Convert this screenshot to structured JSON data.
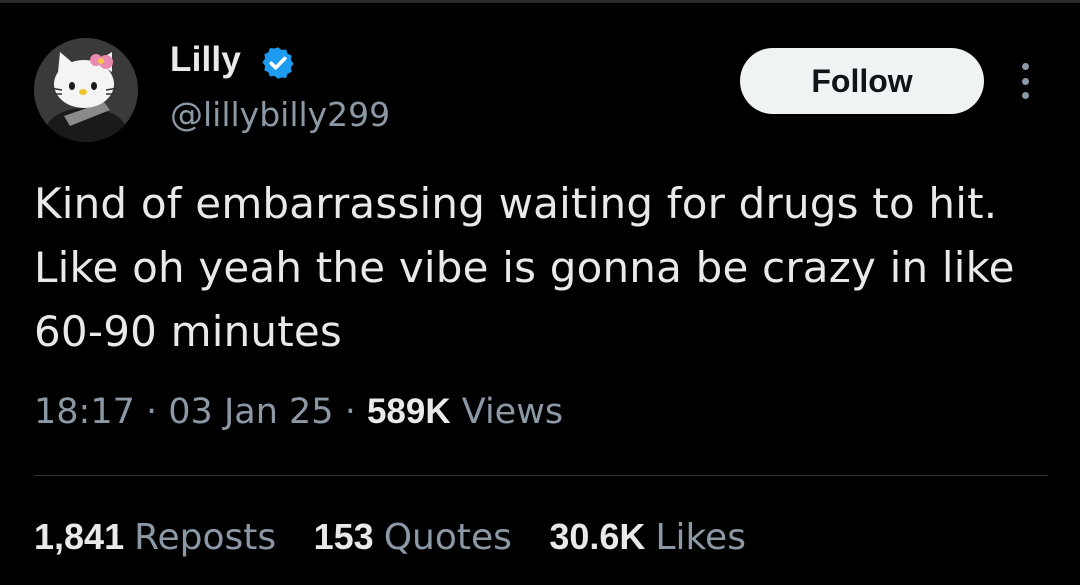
{
  "author": {
    "display_name": "Lilly",
    "handle": "@lillybilly299",
    "verified": true,
    "avatar_icon": "hello-kitty-avatar"
  },
  "actions": {
    "follow_label": "Follow",
    "more_icon": "more-vertical-icon"
  },
  "tweet": {
    "text": "Kind of embarrassing waiting for drugs to hit. Like oh yeah the vibe is gonna be crazy in like 60-90 minutes",
    "time": "18:17",
    "date": "03 Jan 25",
    "views_count": "589K",
    "views_label": "Views"
  },
  "stats": {
    "reposts_count": "1,841",
    "reposts_label": "Reposts",
    "quotes_count": "153",
    "quotes_label": "Quotes",
    "likes_count": "30.6K",
    "likes_label": "Likes"
  },
  "colors": {
    "background": "#000000",
    "primary_text": "#e7e9ea",
    "secondary_text": "#8b98a5",
    "verified_badge": "#1d9bf0",
    "follow_button_bg": "#eff3f4"
  }
}
